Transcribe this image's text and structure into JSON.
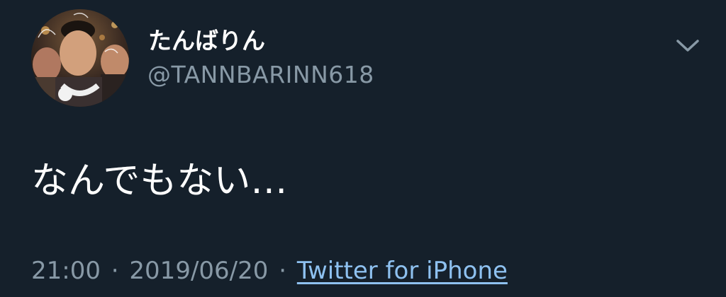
{
  "tweet": {
    "display_name": "たんばりん",
    "handle": "@TANNBARINN618",
    "text": "なんでもない…",
    "time": "21:00",
    "date": "2019/06/20",
    "separator": "·",
    "source": "Twitter for iPhone"
  },
  "icons": {
    "avatar": "profile-photo",
    "menu": "chevron-down-icon"
  },
  "colors": {
    "background": "#15202b",
    "primary_text": "#ffffff",
    "secondary_text": "#8899a6",
    "link": "#8ec1f0"
  }
}
